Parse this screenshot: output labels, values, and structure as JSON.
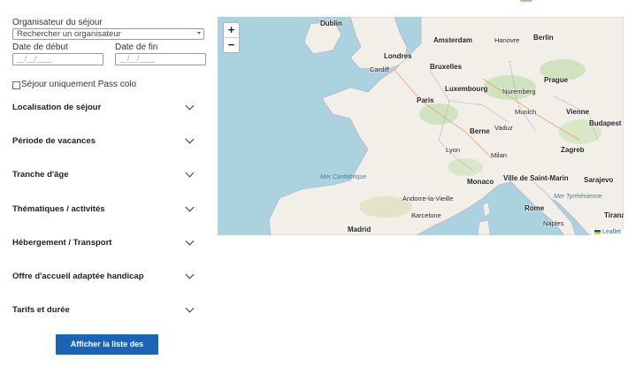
{
  "filters": {
    "organizer_label": "Organisateur du séjour",
    "organizer_placeholder": "Rechercher un organisateur",
    "start_label": "Date de début",
    "end_label": "Date de fin",
    "start_placeholder": "__/__/____",
    "end_placeholder": "__/__/____",
    "pass_colo_label": "Séjour uniquement Pass colo"
  },
  "accordions": [
    {
      "label": "Localisation de séjour"
    },
    {
      "label": "Période de vacances"
    },
    {
      "label": "Tranche d'âge"
    },
    {
      "label": "Thématiques / activités"
    },
    {
      "label": "Hébergement / Transport"
    },
    {
      "label": "Offre d'accueil adaptée handicap"
    },
    {
      "label": "Tarifs et durée"
    }
  ],
  "submit_label": "Afficher la liste des séjours",
  "map": {
    "zoom_in": "+",
    "zoom_out": "−",
    "attribution": "Leaflet",
    "cities": [
      "Dublin",
      "Londres",
      "Amsterdam",
      "Berlin",
      "Bruxelles",
      "Luxembourg",
      "Paris",
      "Prague",
      "Munich",
      "Vienne",
      "Berne",
      "Vaduz",
      "Budapest",
      "Milan",
      "Lyon",
      "Zagreb",
      "Monaco",
      "Ville de Saint-Marin",
      "Sarajevo",
      "Andorre-la-Vieille",
      "Rome",
      "Barcelone",
      "Madrid",
      "Tirana",
      "Naples",
      "Hanovre",
      "Nuremberg",
      "Cardiff"
    ],
    "seas": [
      "Mer Cantabrique",
      "Mer Tyrrhénienne"
    ]
  },
  "colors": {
    "button": "#1d63b4",
    "water": "#aad3df",
    "land": "#f2efe9"
  }
}
